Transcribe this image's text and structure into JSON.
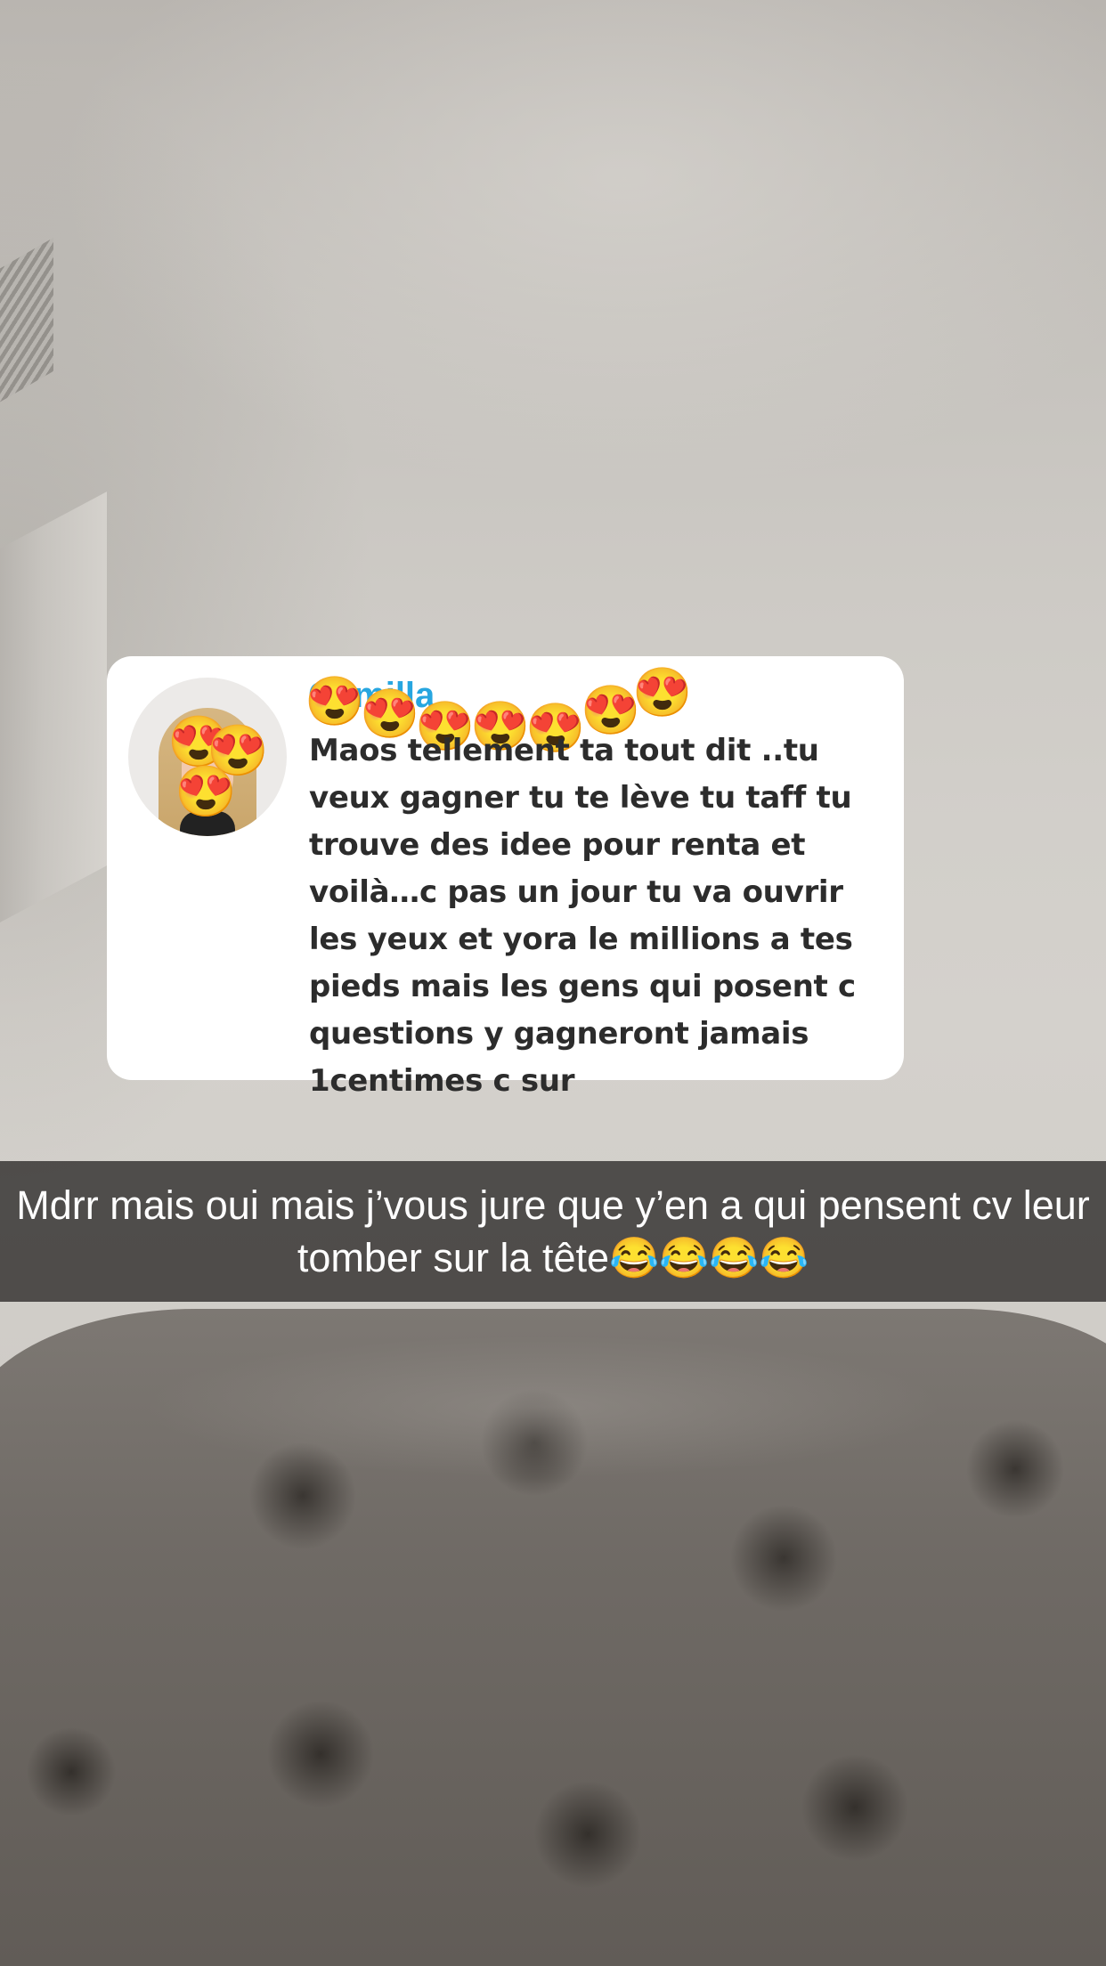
{
  "background": {
    "scene": "ceiling-and-tufted-sofa",
    "colors": {
      "wall": "#d2cfca",
      "sofa": "#6f6a65"
    }
  },
  "reply_card": {
    "username": "Camilla",
    "name_emojis": [
      "😍",
      "😍",
      "😍",
      "😍",
      "😍",
      "😍",
      "😍"
    ],
    "avatar_emojis": [
      "😍",
      "😍",
      "😍"
    ],
    "message": "Maos tellement ta tout dit ..tu veux gagner tu te lève tu taff tu trouve des idee pour renta et voilà…c pas un jour tu va ouvrir les yeux et yora le millions a tes pieds mais les gens qui posent c questions y gagneront jamais 1centimes c sur"
  },
  "caption": {
    "text": "Mdrr mais oui mais j’vous jure que y’en a qui pensent cv leur tomber sur la tête😂😂😂😂"
  }
}
